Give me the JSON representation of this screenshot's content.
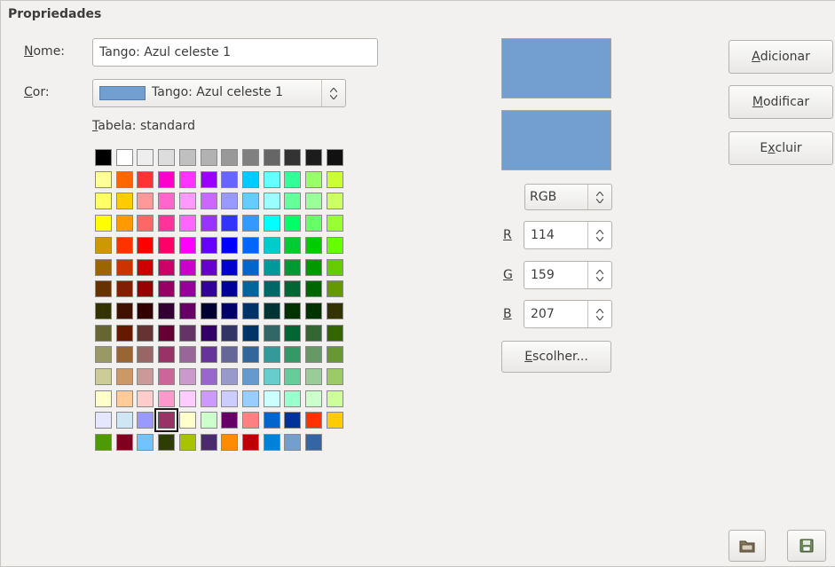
{
  "section_title": "Propriedades",
  "name_field": {
    "label_ul": "N",
    "label_rest": "ome:",
    "value": "Tango: Azul celeste 1"
  },
  "color_field": {
    "label_ul": "C",
    "label_rest": "or:",
    "value": "Tango: Azul celeste 1",
    "swatch_color": "#729fcf"
  },
  "table": {
    "label_ul": "T",
    "label_rest": "abela: standard"
  },
  "mode_select": {
    "value": "RGB"
  },
  "rgb": {
    "r": {
      "label": "R",
      "value": "114"
    },
    "g": {
      "label": "G",
      "value": "159"
    },
    "b": {
      "label": "B",
      "value": "207"
    }
  },
  "buttons": {
    "choose": {
      "ul": "E",
      "rest": "scolher..."
    },
    "add": {
      "ul": "A",
      "rest": "dicionar"
    },
    "modify": {
      "ul": "M",
      "rest": "odificar"
    },
    "delete": {
      "pre": "E",
      "ul": "x",
      "rest": "cluir"
    }
  },
  "preview": {
    "old_color": "#729fcf",
    "new_color": "#729fcf"
  },
  "icons": {
    "load": "folder-icon",
    "save": "floppy-disk-icon"
  },
  "palette": {
    "selected_index": 147,
    "rows": [
      [
        "#000000",
        "#ffffff",
        "#eeeeee",
        "#dddddd",
        "#c0c0c0",
        "#b2b2b2",
        "#999999",
        "#808080",
        "#666666",
        "#333333",
        "#1c1c1c",
        "#111111"
      ],
      [
        "#ffff99",
        "#ff6600",
        "#ff3333",
        "#ff00cc",
        "#ff33ff",
        "#9900ff",
        "#6666ff",
        "#00ccff",
        "#66ffff",
        "#33ff99",
        "#99ff66",
        "#ccff33"
      ],
      [
        "#ffff66",
        "#ffcc00",
        "#ff9999",
        "#ff66cc",
        "#ff99ff",
        "#cc66ff",
        "#9999ff",
        "#66ccff",
        "#99ffff",
        "#66ff99",
        "#99ff99",
        "#ccff66"
      ],
      [
        "#ffff00",
        "#ff9900",
        "#ff6666",
        "#ff3399",
        "#ff66ff",
        "#9933ff",
        "#3333ff",
        "#3399ff",
        "#00ffff",
        "#00ff66",
        "#66ff66",
        "#99ff33"
      ],
      [
        "#cc9900",
        "#ff3300",
        "#ff0000",
        "#ff0066",
        "#ff00ff",
        "#6600ff",
        "#0000ff",
        "#0066ff",
        "#00cccc",
        "#00cc33",
        "#00cc00",
        "#66ff00"
      ],
      [
        "#996600",
        "#cc3300",
        "#cc0000",
        "#cc0066",
        "#cc00cc",
        "#6600cc",
        "#0000cc",
        "#0066cc",
        "#009999",
        "#009933",
        "#009900",
        "#66cc00"
      ],
      [
        "#663300",
        "#802000",
        "#990000",
        "#990066",
        "#990099",
        "#330099",
        "#000099",
        "#006699",
        "#006666",
        "#006633",
        "#006600",
        "#669900"
      ],
      [
        "#333300",
        "#401000",
        "#330000",
        "#330033",
        "#660066",
        "#000033",
        "#000066",
        "#003366",
        "#003333",
        "#003300",
        "#003300",
        "#333300"
      ],
      [
        "#666633",
        "#661900",
        "#663333",
        "#660033",
        "#663366",
        "#330066",
        "#333366",
        "#003366",
        "#336666",
        "#006633",
        "#336633",
        "#336600"
      ],
      [
        "#999966",
        "#996633",
        "#996666",
        "#993366",
        "#996699",
        "#663399",
        "#666699",
        "#336699",
        "#339999",
        "#339966",
        "#669966",
        "#669933"
      ],
      [
        "#cccc99",
        "#cc9966",
        "#cc9999",
        "#cc6699",
        "#cc99cc",
        "#9966cc",
        "#9999cc",
        "#6699cc",
        "#66cccc",
        "#66cc99",
        "#99cc99",
        "#99cc66"
      ],
      [
        "#ffffcc",
        "#ffcc99",
        "#ffcccc",
        "#ff99cc",
        "#ffccff",
        "#cc99ff",
        "#ccccff",
        "#99ccff",
        "#ccffff",
        "#99ffcc",
        "#ccffcc",
        "#ccff99"
      ],
      [
        "#e6e6ff",
        "#cfe7f5",
        "#9999ff",
        "#993366",
        "#ffffcc",
        "#ccffcc",
        "#660066",
        "#ff8080",
        "#0066cc",
        "#003399",
        "#ff3300",
        "#ffcc00"
      ],
      [
        "#4e9a06",
        "#800020",
        "#6fc3ff",
        "#2e3d00",
        "#a8c400",
        "#4b2a6e",
        "#ff8c00",
        "#c00000",
        "#0083d6",
        "#729fcf",
        "#3465a4"
      ]
    ]
  }
}
